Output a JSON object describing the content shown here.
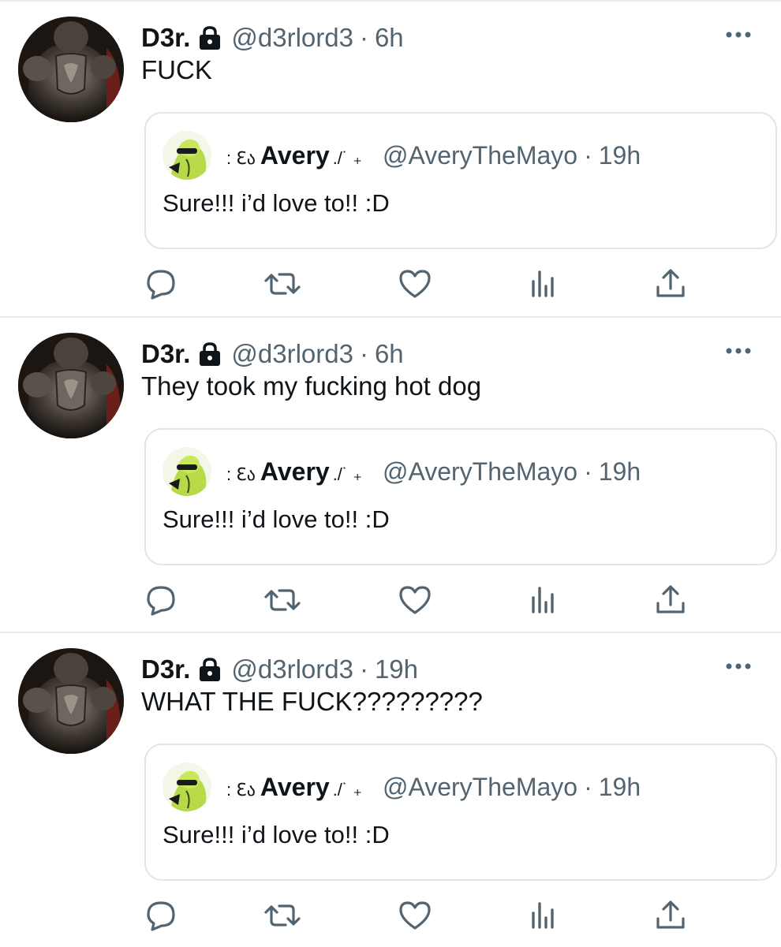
{
  "tweets": [
    {
      "author": {
        "display_name": "D3r.",
        "handle": "@d3rlord3",
        "protected_icon": "lock-icon"
      },
      "separator": "·",
      "time": "6h",
      "text": "FUCK",
      "quoted": {
        "prefix": ": ℇა",
        "display_name": "Avery",
        "suffix": "./˙ ₊",
        "handle": "@AveryTheMayo",
        "separator": "·",
        "time": "19h",
        "text": "Sure!!! i’d love to!! :D"
      }
    },
    {
      "author": {
        "display_name": "D3r.",
        "handle": "@d3rlord3",
        "protected_icon": "lock-icon"
      },
      "separator": "·",
      "time": "6h",
      "text": "They took my fucking hot dog",
      "quoted": {
        "prefix": ": ℇა",
        "display_name": "Avery",
        "suffix": "./˙ ₊",
        "handle": "@AveryTheMayo",
        "separator": "·",
        "time": "19h",
        "text": "Sure!!! i’d love to!! :D"
      }
    },
    {
      "author": {
        "display_name": "D3r.",
        "handle": "@d3rlord3",
        "protected_icon": "lock-icon"
      },
      "separator": "·",
      "time": "19h",
      "text": "WHAT THE FUCK?????????",
      "quoted": {
        "prefix": ": ℇა",
        "display_name": "Avery",
        "suffix": "./˙ ₊",
        "handle": "@AveryTheMayo",
        "separator": "·",
        "time": "19h",
        "text": "Sure!!! i’d love to!! :D"
      }
    }
  ],
  "icons": {
    "more": "more-horizontal-icon",
    "reply": "reply-bubble-icon",
    "retweet": "retweet-icon",
    "like": "heart-icon",
    "views": "views-bar-chart-icon",
    "share": "share-upload-icon"
  },
  "colors": {
    "text_primary": "#0f1419",
    "text_secondary": "#536471",
    "divider": "#e6ecf0",
    "quote_border": "#dfe5ea"
  }
}
